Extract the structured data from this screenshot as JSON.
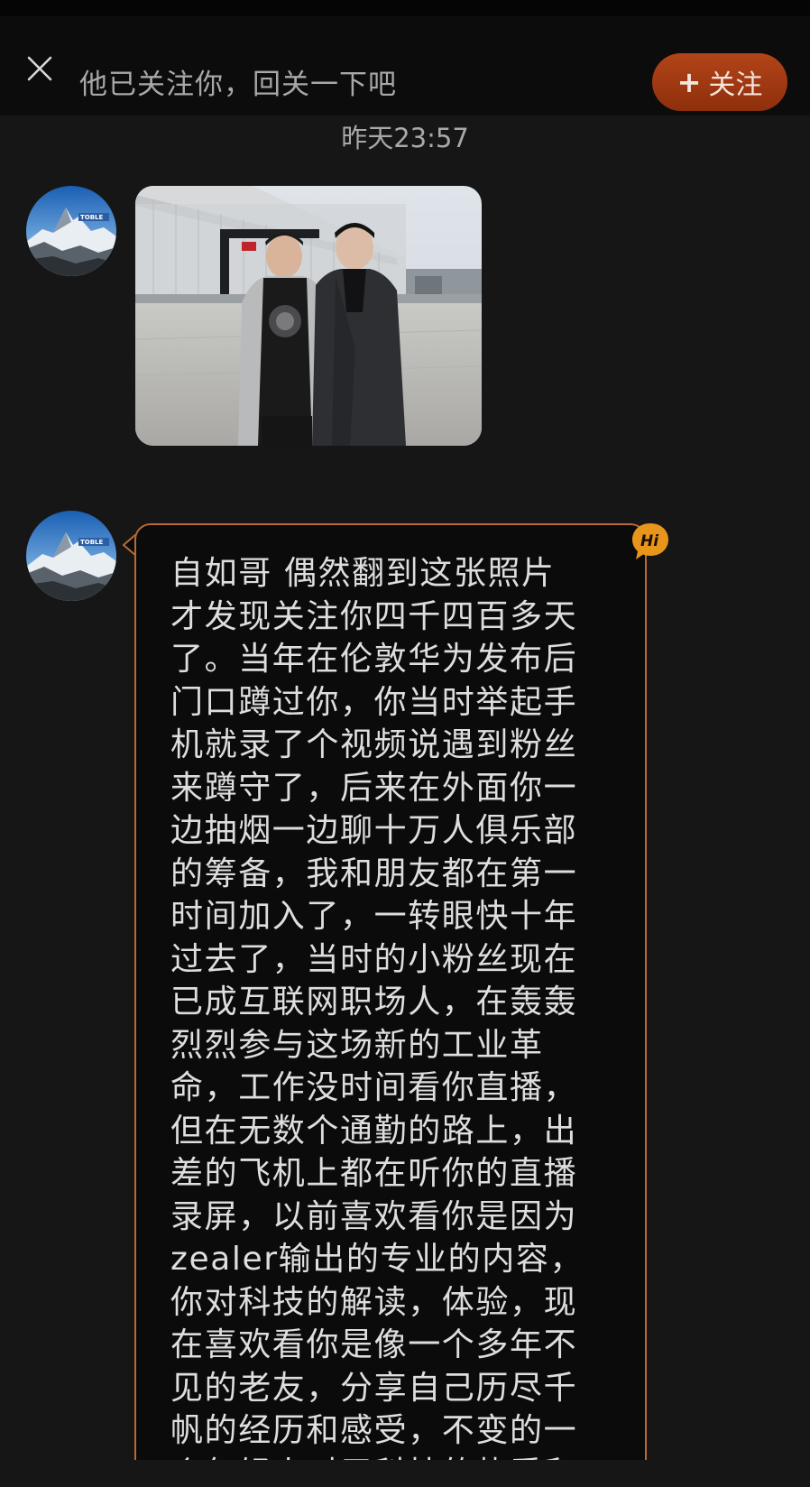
{
  "banner": {
    "close_icon": "close-icon",
    "text": "他已关注你，回关一下吧",
    "follow_plus": "+",
    "follow_label": "关注",
    "accent_color": "#a03a12"
  },
  "chat": {
    "timestamp": "昨天23:57",
    "messages": [
      {
        "type": "image",
        "sender_avatar": "mountain-avatar",
        "alt_description": "photo-message"
      },
      {
        "type": "text",
        "sender_avatar": "mountain-avatar",
        "badge": "Hi",
        "text": "自如哥 偶然翻到这张照片\n才发现关注你四千四百多天\n了。当年在伦敦华为发布后\n门口蹲过你，你当时举起手\n机就录了个视频说遇到粉丝\n来蹲守了，后来在外面你一\n边抽烟一边聊十万人俱乐部\n的筹备，我和朋友都在第一\n时间加入了，一转眼快十年\n过去了，当时的小粉丝现在\n已成互联网职场人，在轰轰\n烈烈参与这场新的工业革\n命，工作没时间看你直播，\n但在无数个通勤的路上，出\n差的飞机上都在听你的直播\n录屏，以前喜欢看你是因为\nzealer输出的专业的内容，\n你对科技的解读，体验，现\n在喜欢看你是像一个多年不\n见的老友，分享自己历尽千\n帆的经历和感受，不变的一\n个年轻人对于科技的热爱和"
      }
    ]
  },
  "colors": {
    "background": "#161616",
    "bubble_border": "#b96a34",
    "hi_badge": "#e8951c"
  }
}
